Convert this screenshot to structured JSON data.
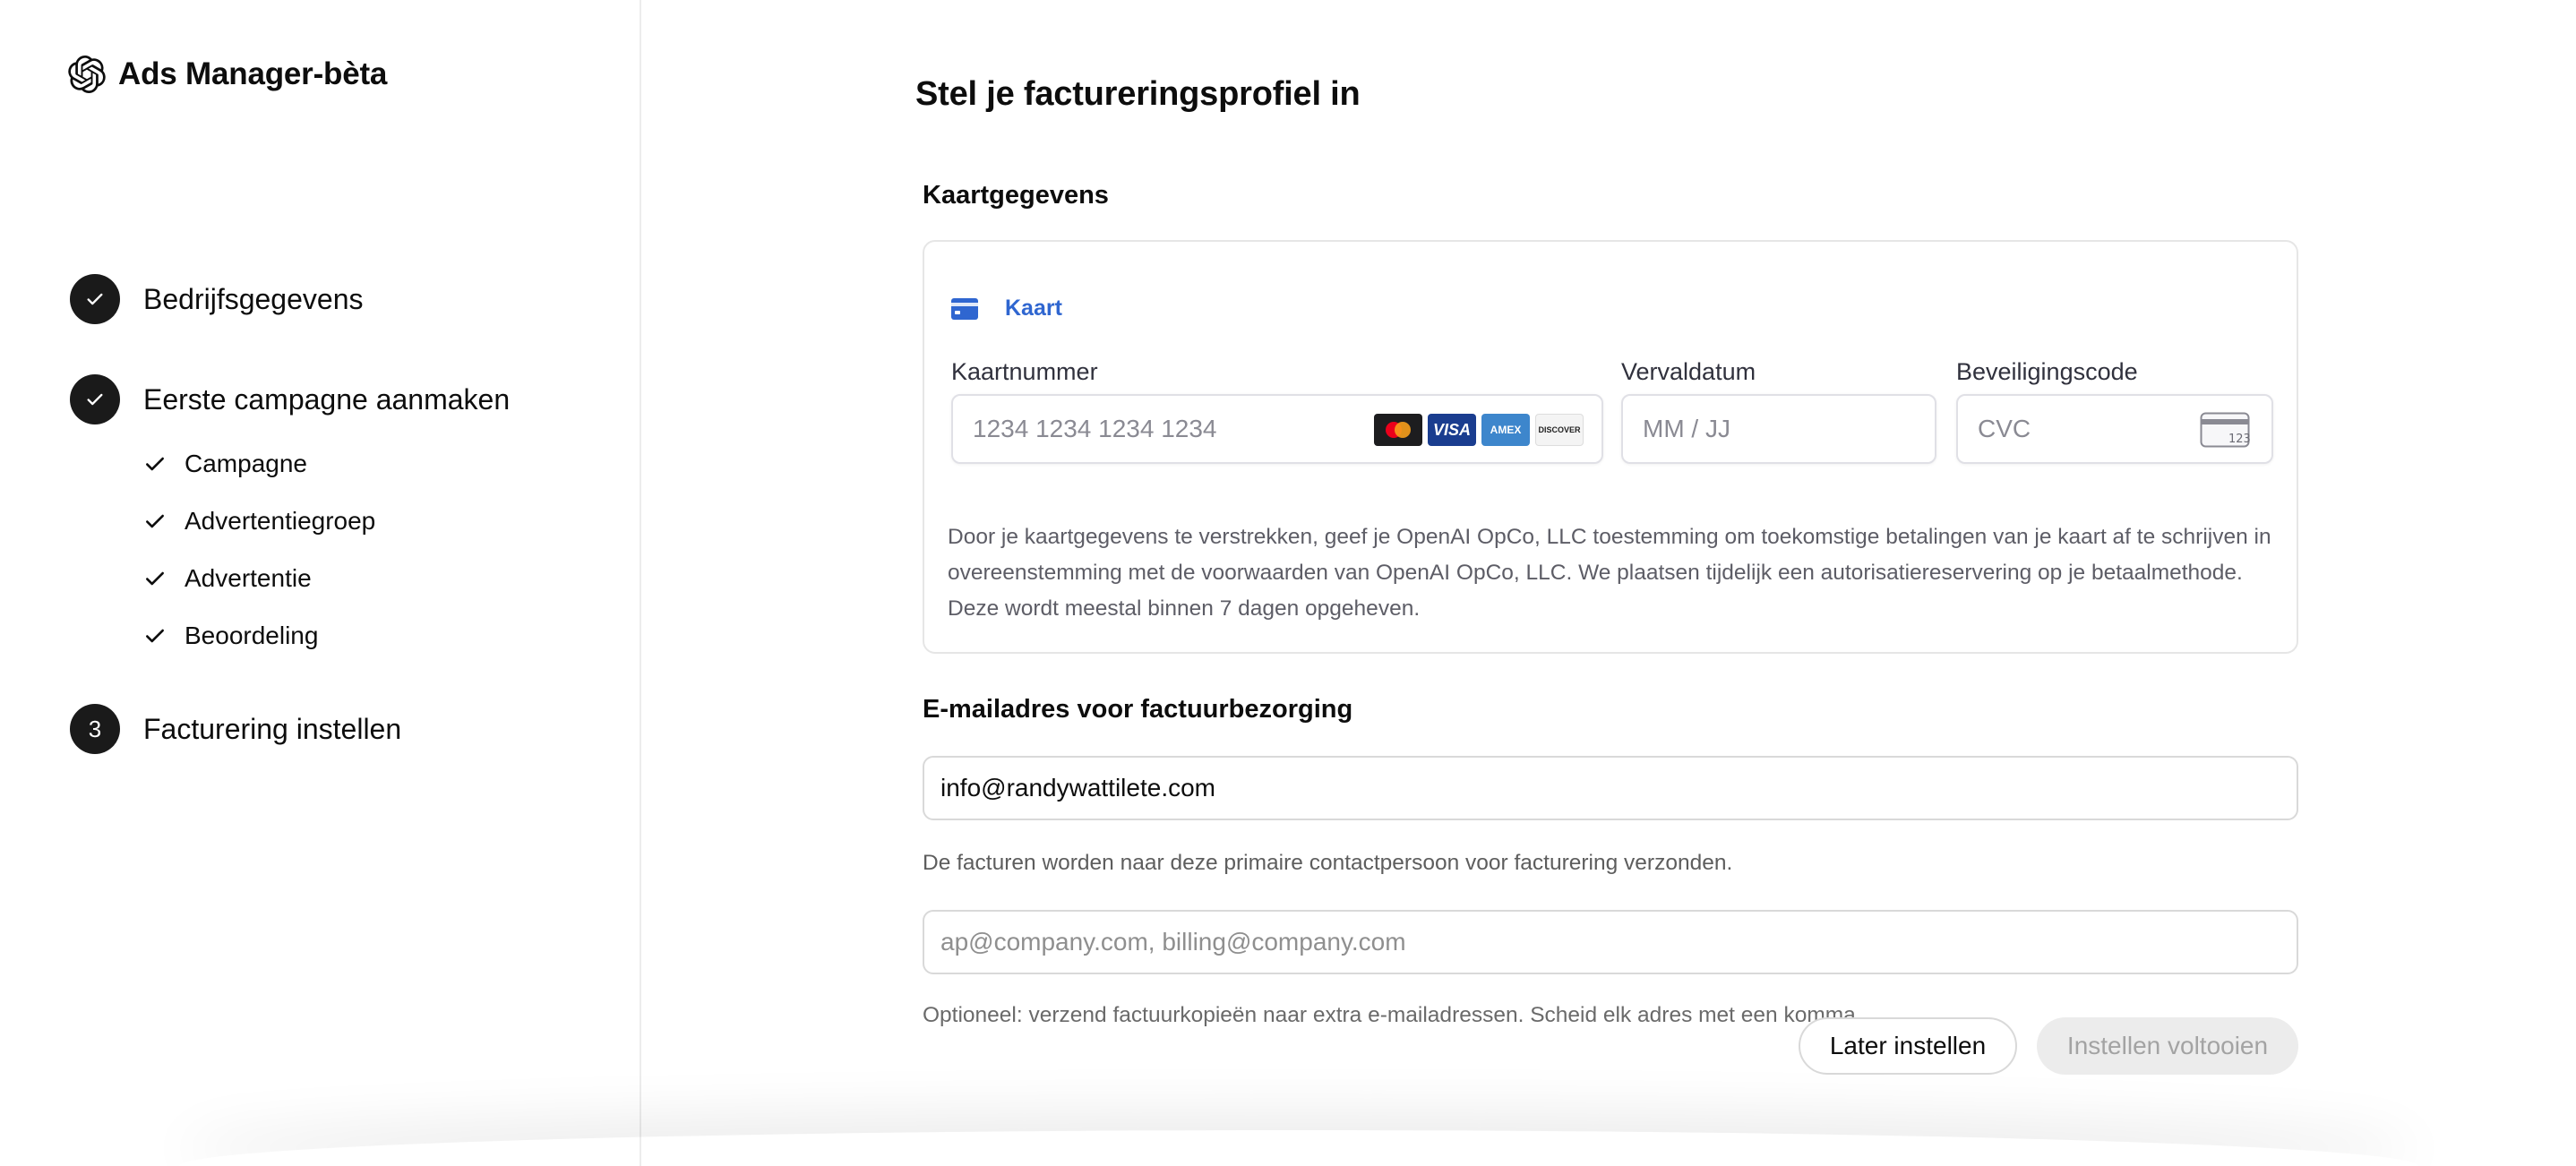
{
  "app": {
    "title": "Ads Manager-bèta",
    "logo_icon": "openai-logo-icon"
  },
  "steps": [
    {
      "label": "Bedrijfsgegevens",
      "status": "done",
      "marker": "✓"
    },
    {
      "label": "Eerste campagne aanmaken",
      "status": "done",
      "marker": "✓",
      "substeps": [
        "Campagne",
        "Advertentiegroep",
        "Advertentie",
        "Beoordeling"
      ]
    },
    {
      "label": "Facturering instellen",
      "status": "current",
      "marker": "3"
    }
  ],
  "main": {
    "title": "Stel je factureringsprofiel in",
    "card_section": {
      "title": "Kaartgegevens",
      "tab_label": "Kaart",
      "tab_icon": "credit-card-icon",
      "tab_color": "#2f66d0",
      "card_number": {
        "label": "Kaartnummer",
        "placeholder": "1234 1234 1234 1234",
        "brands": [
          "mastercard",
          "visa",
          "amex",
          "discover"
        ]
      },
      "expiry": {
        "label": "Vervaldatum",
        "placeholder": "MM / JJ"
      },
      "cvc": {
        "label": "Beveiligingscode",
        "placeholder": "CVC",
        "icon": "cvc-card-icon",
        "icon_text": "123"
      },
      "consent": "Door je kaartgegevens te verstrekken, geef je OpenAI OpCo, LLC toestemming om toekomstige betalingen van je kaart af te schrijven in overeenstemming met de voorwaarden van OpenAI OpCo, LLC. We plaatsen tijdelijk een autorisatiereservering op je betaalmethode. Deze wordt meestal binnen 7 dagen opgeheven."
    },
    "email_section": {
      "title": "E-mailadres voor factuurbezorging",
      "primary_value": "info@randywattilete.com",
      "primary_helper": "De facturen worden naar deze primaire contactpersoon voor facturering verzonden.",
      "extra_placeholder": "ap@company.com, billing@company.com",
      "extra_helper": "Optioneel: verzend factuurkopieën naar extra e-mailadressen. Scheid elk adres met een komma."
    },
    "buttons": {
      "later": "Later instellen",
      "finish": "Instellen voltooien"
    }
  },
  "brand_labels": {
    "visa": "VISA",
    "amex": "AMEX",
    "discover": "DISCOVER"
  }
}
